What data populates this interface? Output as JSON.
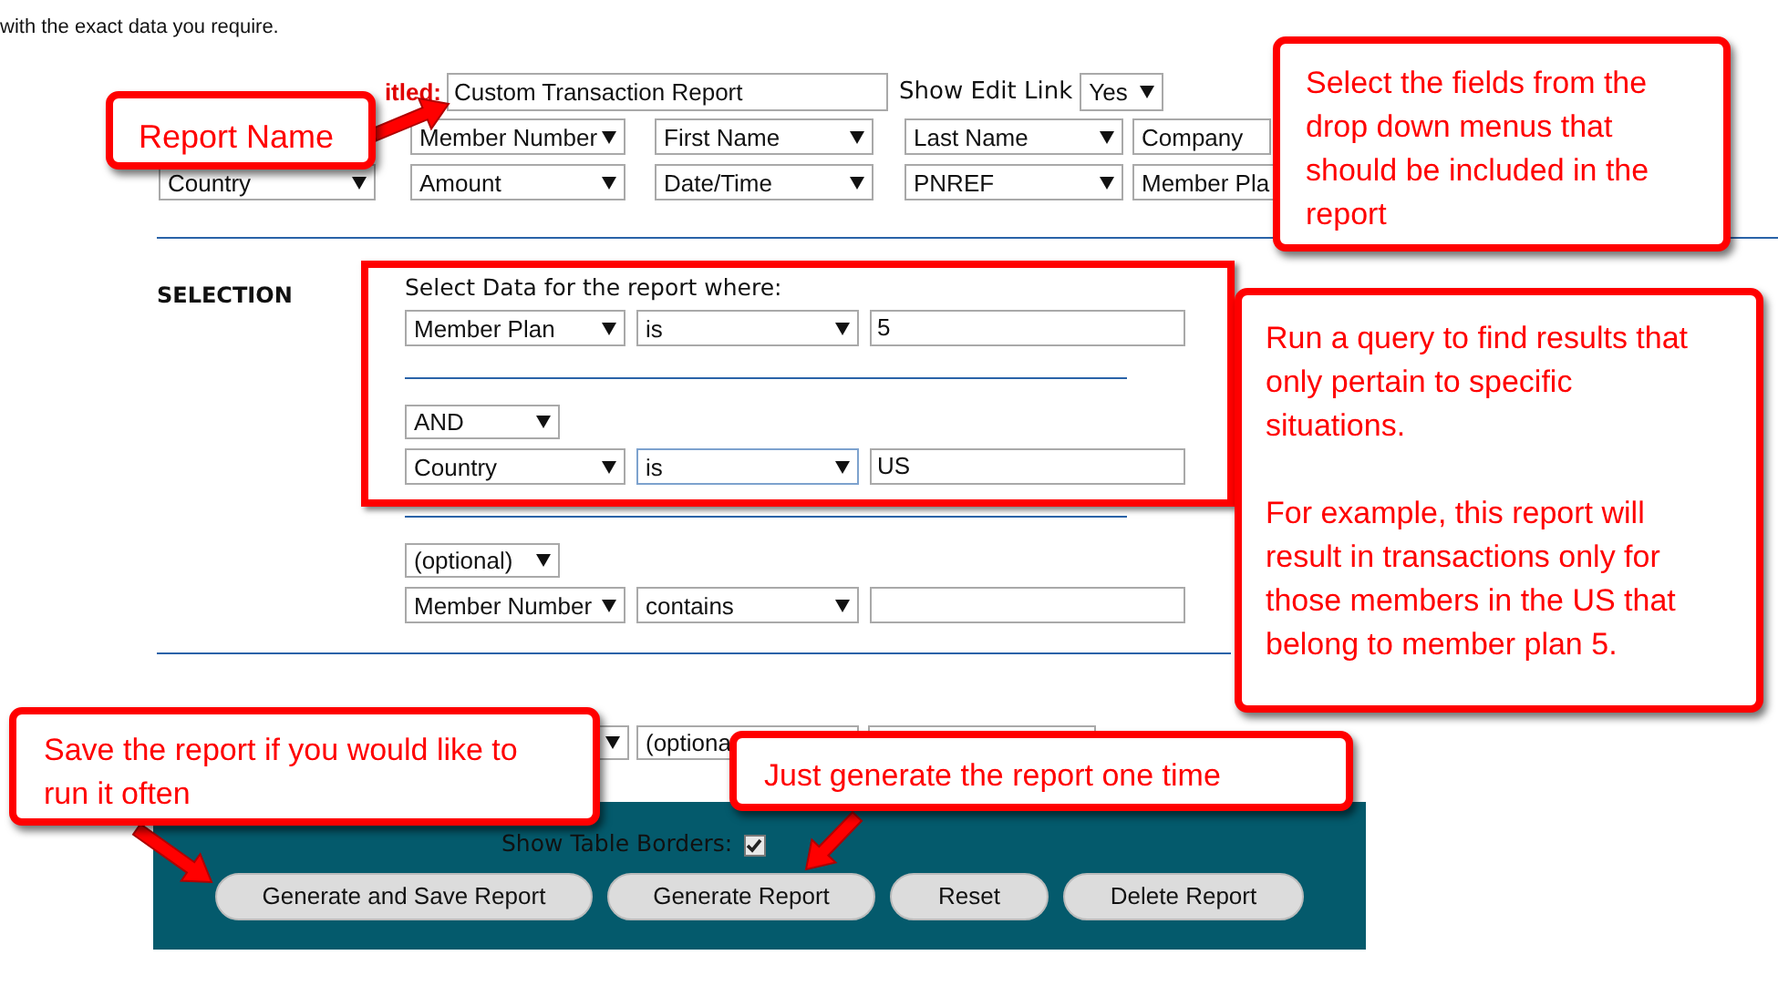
{
  "intro": "with the exact data you require.",
  "report": {
    "title_label": "itled:",
    "title_value": "Custom Transaction Report",
    "edit_link_label": "Show Edit Link",
    "edit_link_value": "Yes"
  },
  "field_rows": [
    [
      {
        "value": "Member Number"
      },
      {
        "value": "First Name"
      },
      {
        "value": "Last Name"
      },
      {
        "value": "Company"
      }
    ],
    [
      {
        "value": "Country"
      },
      {
        "value": "Amount"
      },
      {
        "value": "Date/Time"
      },
      {
        "value": "PNREF"
      },
      {
        "value": "Member Pla"
      }
    ]
  ],
  "selection": {
    "heading": "SELECTION",
    "prompt": "Select Data for the report where:",
    "conditions": [
      {
        "field": "Member Plan",
        "operator": "is",
        "operator_focused": false,
        "value": "5"
      },
      {
        "connector": "AND",
        "field": "Country",
        "operator": "is",
        "operator_focused": true,
        "value": "US"
      },
      {
        "connector": "(optional)",
        "field": "Member Number",
        "operator": "contains",
        "operator_focused": false
      }
    ]
  },
  "sort_options": {
    "controls": [
      {
        "kind": "select"
      },
      {
        "kind": "select",
        "value": "(optiona"
      },
      {
        "kind": "blank"
      }
    ]
  },
  "actions": {
    "show_borders_label": "Show Table Borders:",
    "show_borders_checked": true,
    "buttons": [
      {
        "label": "Generate and Save Report"
      },
      {
        "label": "Generate Report"
      },
      {
        "label": "Reset"
      },
      {
        "label": "Delete Report"
      }
    ]
  },
  "callouts": [
    {
      "paragraphs": [
        "Report Name"
      ]
    },
    {
      "paragraphs": [
        "Select the fields from the drop down menus that should be included in the report"
      ]
    },
    {
      "paragraphs": [
        "Run a query to find results that only pertain to specific situations.",
        "For example, this report will result in transactions only for those members in the US that belong to member plan 5."
      ]
    },
    {
      "paragraphs": [
        "Save the report if you would like to run it often"
      ]
    },
    {
      "paragraphs": [
        "Just generate the report one time"
      ]
    }
  ]
}
